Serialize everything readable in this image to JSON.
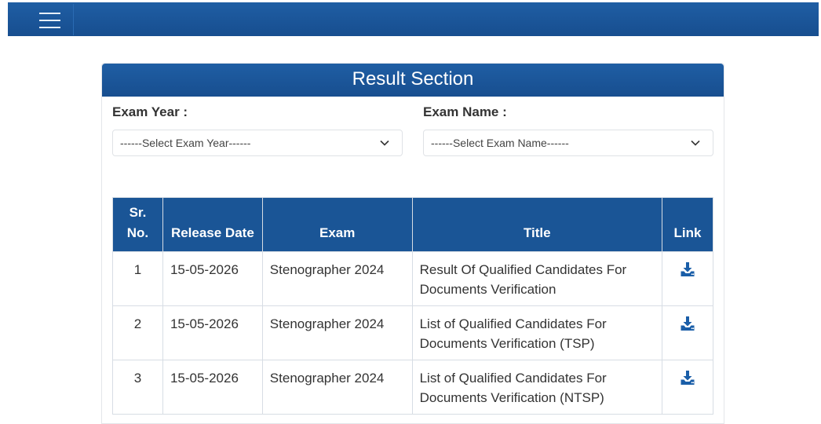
{
  "navbar": {
    "menu_icon": "hamburger-menu-icon"
  },
  "card": {
    "title": "Result Section"
  },
  "filters": {
    "exam_year": {
      "label": "Exam Year :",
      "selected": "------Select Exam Year------",
      "icon": "chevron-down-icon"
    },
    "exam_name": {
      "label": "Exam Name :",
      "selected": "------Select Exam Name------",
      "icon": "chevron-down-icon"
    }
  },
  "table": {
    "headers": {
      "sr_line1": "Sr.",
      "sr_line2": "No.",
      "release_date": "Release Date",
      "exam": "Exam",
      "title": "Title",
      "link": "Link"
    },
    "rows": [
      {
        "sr": "1",
        "release_date": "15-05-2026",
        "exam": "Stenographer 2024",
        "title": "Result Of Qualified Candidates For Documents Verification",
        "link_icon": "download-icon"
      },
      {
        "sr": "2",
        "release_date": "15-05-2026",
        "exam": "Stenographer 2024",
        "title": "List of Qualified Candidates For Documents Verification (TSP)",
        "link_icon": "download-icon"
      },
      {
        "sr": "3",
        "release_date": "15-05-2026",
        "exam": "Stenographer 2024",
        "title": "List of Qualified Candidates For Documents Verification (NTSP)",
        "link_icon": "download-icon"
      }
    ]
  },
  "colors": {
    "primary": "#1a5596",
    "header_gradient_top": "#1f5ea4",
    "icon": "#1a5ea8"
  }
}
